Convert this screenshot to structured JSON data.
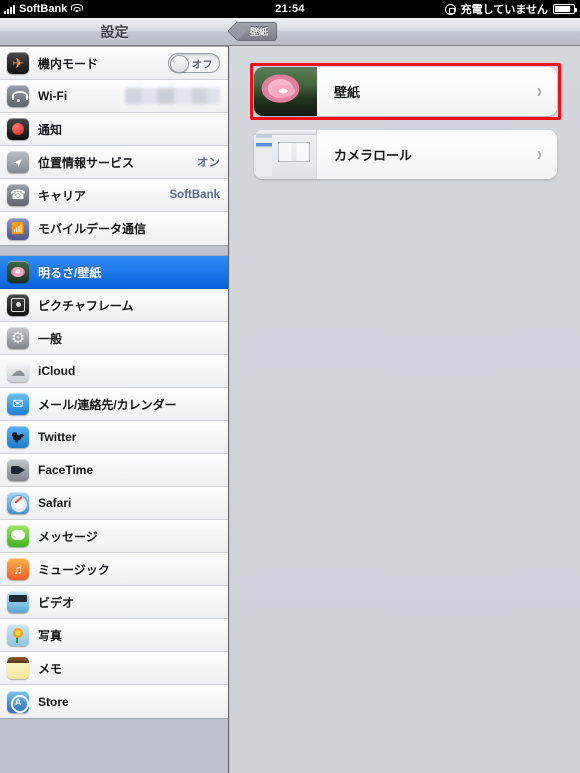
{
  "status_bar": {
    "carrier": "SoftBank",
    "signal_icon": "signal-bars-icon",
    "wifi_icon": "wifi-icon",
    "time": "21:54",
    "rotation_lock_icon": "rotation-lock-icon",
    "battery_text": "充電していません",
    "battery_icon": "battery-icon"
  },
  "nav": {
    "settings_title": "設定",
    "back_label": "壁紙"
  },
  "sidebar": {
    "groups": [
      {
        "items": [
          {
            "label": "機内モード",
            "icon": "airplane-icon",
            "control": "toggle",
            "toggle_label": "オフ",
            "toggle_on": false,
            "value": ""
          },
          {
            "label": "Wi-Fi",
            "icon": "wifi-icon",
            "control": "blurred",
            "value": ""
          },
          {
            "label": "通知",
            "icon": "notifications-icon",
            "control": "none",
            "value": ""
          },
          {
            "label": "位置情報サービス",
            "icon": "location-icon",
            "control": "value",
            "value": "オン"
          },
          {
            "label": "キャリア",
            "icon": "carrier-phone-icon",
            "control": "value",
            "value": "SoftBank"
          },
          {
            "label": "モバイルデータ通信",
            "icon": "cellular-icon",
            "control": "none",
            "value": ""
          }
        ]
      },
      {
        "items": [
          {
            "label": "明るさ/壁紙",
            "icon": "brightness-wallpaper-icon",
            "control": "none",
            "value": "",
            "selected": true
          },
          {
            "label": "ピクチャフレーム",
            "icon": "picture-frame-icon",
            "control": "none",
            "value": ""
          },
          {
            "label": "一般",
            "icon": "general-gear-icon",
            "control": "none",
            "value": ""
          },
          {
            "label": "iCloud",
            "icon": "icloud-icon",
            "control": "none",
            "value": ""
          },
          {
            "label": "メール/連絡先/カレンダー",
            "icon": "mail-icon",
            "control": "none",
            "value": ""
          },
          {
            "label": "Twitter",
            "icon": "twitter-icon",
            "control": "none",
            "value": ""
          },
          {
            "label": "FaceTime",
            "icon": "facetime-icon",
            "control": "none",
            "value": ""
          },
          {
            "label": "Safari",
            "icon": "safari-icon",
            "control": "none",
            "value": ""
          },
          {
            "label": "メッセージ",
            "icon": "messages-icon",
            "control": "none",
            "value": ""
          },
          {
            "label": "ミュージック",
            "icon": "music-icon",
            "control": "none",
            "value": ""
          },
          {
            "label": "ビデオ",
            "icon": "video-icon",
            "control": "none",
            "value": ""
          },
          {
            "label": "写真",
            "icon": "photos-icon",
            "control": "none",
            "value": ""
          },
          {
            "label": "メモ",
            "icon": "notes-icon",
            "control": "none",
            "value": ""
          },
          {
            "label": "Store",
            "icon": "store-icon",
            "control": "none",
            "value": ""
          }
        ]
      }
    ]
  },
  "detail": {
    "rows": [
      {
        "label": "壁紙",
        "thumb": "lotus-flower-thumbnail",
        "chevron": "›",
        "highlighted": true
      },
      {
        "label": "カメラロール",
        "thumb": "camera-roll-screenshot-thumbnail",
        "chevron": "›",
        "highlighted": false
      }
    ]
  },
  "annotation": {
    "highlight_color": "#ee1111"
  }
}
